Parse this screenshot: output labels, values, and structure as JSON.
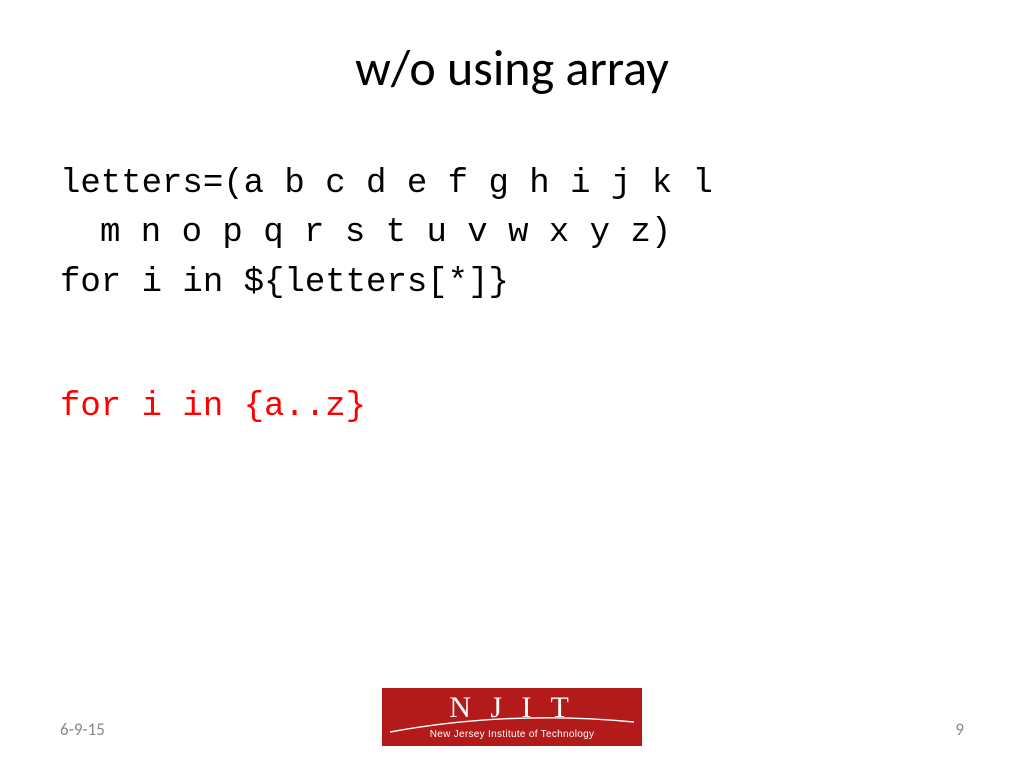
{
  "title": "w/o using array",
  "code": {
    "line1": "letters=(a b c d e f g h i j k l",
    "line1b": "m n o p q r s t u v w x y z)",
    "line2": "for i in ${letters[*]}",
    "line3": "for i in {a..z}"
  },
  "footer": {
    "date": "6-9-15",
    "page": "9"
  },
  "logo": {
    "acronym": "N J I T",
    "full": "New Jersey Institute of Technology"
  }
}
